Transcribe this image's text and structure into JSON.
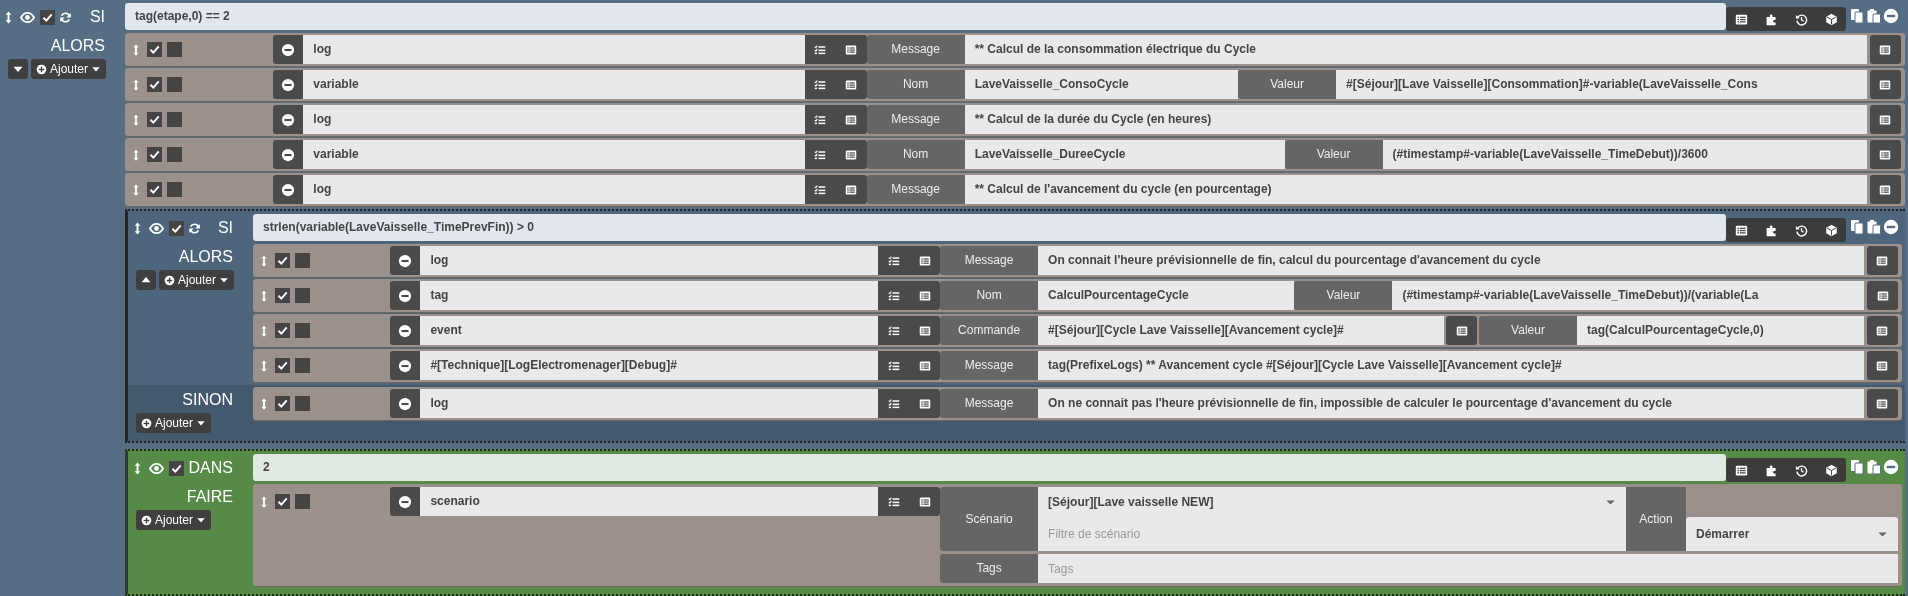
{
  "blocks": [
    {
      "kind": "si",
      "keyword": "SI",
      "enabled": true,
      "condition": "tag(etape,0) == 2",
      "sections": [
        {
          "label": "ALORS",
          "expanded": false,
          "add_button": "Ajouter",
          "items": [
            {
              "kind": "action",
              "enabled": true,
              "parallel": false,
              "name": "log",
              "params": [
                {
                  "label": "Message",
                  "value": "** Calcul de la consommation électrique du Cycle"
                }
              ]
            },
            {
              "kind": "action",
              "enabled": true,
              "parallel": false,
              "name": "variable",
              "params": [
                {
                  "label": "Nom",
                  "value": "LaveVaisselle_ConsoCycle"
                },
                {
                  "label": "Valeur",
                  "value": "#[Séjour][Lave Vaisselle][Consommation]#-variable(LaveVaisselle_Cons"
                }
              ]
            },
            {
              "kind": "action",
              "enabled": true,
              "parallel": false,
              "name": "log",
              "params": [
                {
                  "label": "Message",
                  "value": "** Calcul de la durée du Cycle (en heures)"
                }
              ]
            },
            {
              "kind": "action",
              "enabled": true,
              "parallel": false,
              "name": "variable",
              "params": [
                {
                  "label": "Nom",
                  "value": "LaveVaisselle_DureeCycle"
                },
                {
                  "label": "Valeur",
                  "value": "(#timestamp#-variable(LaveVaisselle_TimeDebut))/3600"
                }
              ]
            },
            {
              "kind": "action",
              "enabled": true,
              "parallel": false,
              "name": "log",
              "params": [
                {
                  "label": "Message",
                  "value": "** Calcul de l'avancement du cycle (en pourcentage)"
                }
              ]
            },
            {
              "kind": "si",
              "keyword": "SI",
              "enabled": true,
              "condition": "strlen(variable(LaveVaisselle_TimePrevFin)) > 0",
              "sections": [
                {
                  "label": "ALORS",
                  "expanded": true,
                  "add_button": "Ajouter",
                  "items": [
                    {
                      "kind": "action",
                      "enabled": true,
                      "parallel": false,
                      "name": "log",
                      "params": [
                        {
                          "label": "Message",
                          "value": "On connait l'heure prévisionnelle de fin, calcul du pourcentage d'avancement du cycle"
                        }
                      ]
                    },
                    {
                      "kind": "action",
                      "enabled": true,
                      "parallel": false,
                      "name": "tag",
                      "params": [
                        {
                          "label": "Nom",
                          "value": "CalculPourcentageCycle"
                        },
                        {
                          "label": "Valeur",
                          "value": "(#timestamp#-variable(LaveVaisselle_TimeDebut))/(variable(La"
                        }
                      ]
                    },
                    {
                      "kind": "action",
                      "enabled": true,
                      "parallel": false,
                      "name": "event",
                      "params": [
                        {
                          "label": "Commande",
                          "value": "#[Séjour][Cycle Lave Vaisselle][Avancement cycle]#",
                          "picker": true
                        },
                        {
                          "label": "Valeur",
                          "value": "tag(CalculPourcentageCycle,0)"
                        }
                      ]
                    },
                    {
                      "kind": "action",
                      "enabled": true,
                      "parallel": false,
                      "name": "#[Technique][LogElectromenager][Debug]#",
                      "params": [
                        {
                          "label": "Message",
                          "value": "tag(PrefixeLogs) ** Avancement cycle #[Séjour][Cycle Lave Vaisselle][Avancement cycle]#"
                        }
                      ]
                    }
                  ]
                },
                {
                  "label": "SINON",
                  "add_button": "Ajouter",
                  "items": [
                    {
                      "kind": "action",
                      "enabled": true,
                      "parallel": false,
                      "name": "log",
                      "params": [
                        {
                          "label": "Message",
                          "value": "On ne connait pas l'heure prévisionnelle de fin, impossible de calculer le pourcentage d'avancement du cycle"
                        }
                      ]
                    }
                  ]
                }
              ]
            },
            {
              "kind": "dans",
              "keyword": "DANS",
              "enabled": true,
              "condition": "2",
              "sections": [
                {
                  "label": "FAIRE",
                  "add_button": "Ajouter",
                  "items": [
                    {
                      "kind": "scenario_action",
                      "enabled": true,
                      "parallel": false,
                      "name": "scenario",
                      "scenario": {
                        "label": "Scénario",
                        "value": "[Séjour][Lave vaisselle NEW]",
                        "filter_placeholder": "Filtre de scénario"
                      },
                      "action": {
                        "label": "Action",
                        "value": "Démarrer"
                      },
                      "tags": {
                        "label": "Tags",
                        "placeholder": "Tags"
                      }
                    }
                  ]
                }
              ]
            }
          ]
        }
      ]
    }
  ]
}
